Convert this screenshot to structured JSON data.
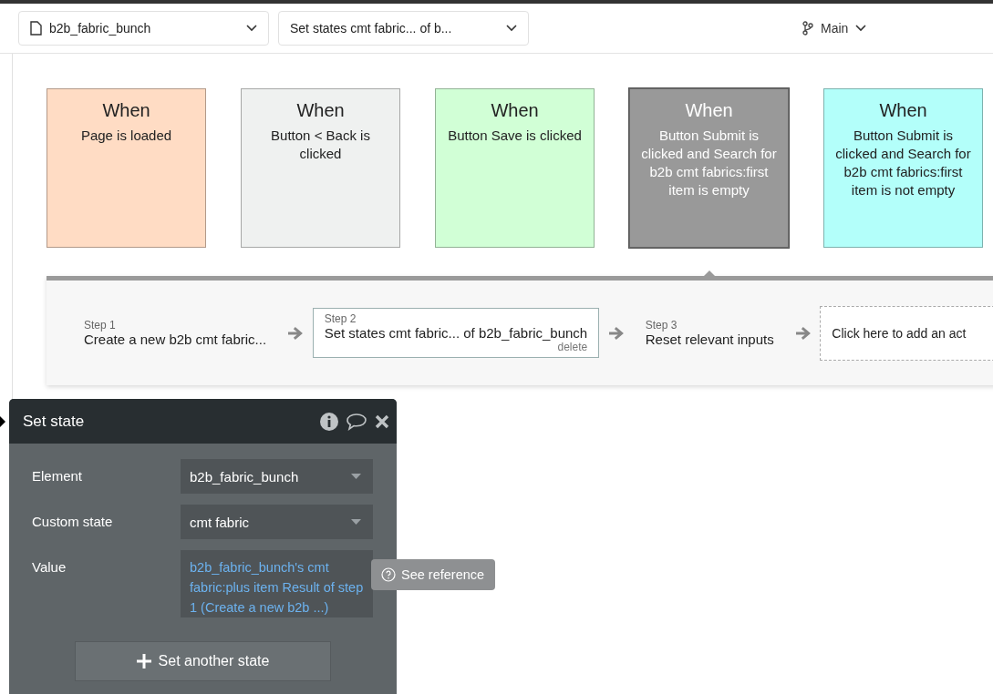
{
  "top_bar": {
    "page_dropdown": "b2b_fabric_bunch",
    "workflow_dropdown": "Set states cmt fabric... of b...",
    "branch": "Main"
  },
  "events": [
    {
      "heading": "When",
      "text": "Page is loaded",
      "color": "#ffdcc4",
      "selected": false
    },
    {
      "heading": "When",
      "text": "Button < Back is clicked",
      "color": "#eff1f0",
      "selected": false
    },
    {
      "heading": "When",
      "text": "Button Save is clicked",
      "color": "#d1ffd6",
      "selected": false
    },
    {
      "heading": "When",
      "text": "Button Submit is clicked and Search for b2b cmt fabrics:first item is empty",
      "color": "#999999",
      "selected": true
    },
    {
      "heading": "When",
      "text": "Button Submit is clicked and Search for b2b cmt fabrics:first item is not empty",
      "color": "#b3fffa",
      "selected": false
    }
  ],
  "steps": [
    {
      "label": "Step 1",
      "text": "Create a new b2b cmt fabric...",
      "selected": false
    },
    {
      "label": "Step 2",
      "text": "Set states cmt fabric... of b2b_fabric_bunch",
      "selected": true,
      "delete": "delete"
    },
    {
      "label": "Step 3",
      "text": "Reset relevant inputs",
      "selected": false
    }
  ],
  "add_action": "Click here to add an act",
  "popup": {
    "title": "Set state",
    "fields": [
      {
        "kind": "dropdown",
        "label": "Element",
        "value": "b2b_fabric_bunch"
      },
      {
        "kind": "dropdown",
        "label": "Custom state",
        "value": "cmt fabric"
      },
      {
        "kind": "expression",
        "label": "Value",
        "value": "b2b_fabric_bunch's cmt fabric:plus item Result of step 1 (Create a new b2b ...)"
      }
    ],
    "tooltip": "See reference",
    "add_button": "Set another state"
  }
}
